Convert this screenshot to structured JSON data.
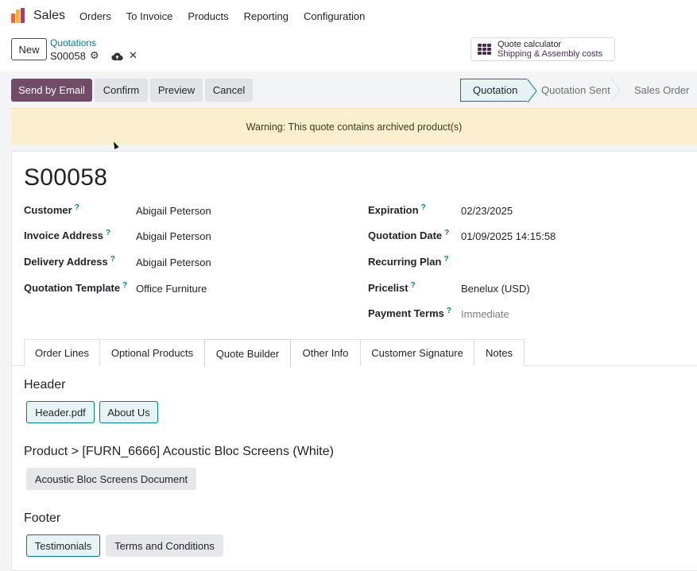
{
  "nav": {
    "app_name": "Sales",
    "items": [
      "Orders",
      "To Invoice",
      "Products",
      "Reporting",
      "Configuration"
    ]
  },
  "control": {
    "new_label": "New",
    "breadcrumb": "Quotations",
    "record_name": "S00058",
    "calculator_title": "Quote calculator",
    "calculator_subtitle": "Shipping & Assembly costs"
  },
  "actions": {
    "send_email": "Send by Email",
    "confirm": "Confirm",
    "preview": "Preview",
    "cancel": "Cancel"
  },
  "status": {
    "stages": [
      "Quotation",
      "Quotation Sent",
      "Sales Order"
    ],
    "active": "Quotation"
  },
  "warning": "Warning: This quote contains archived product(s)",
  "record": {
    "title": "S00058",
    "help_mark": "?",
    "left_fields": [
      {
        "label": "Customer",
        "value": "Abigail Peterson"
      },
      {
        "label": "Invoice Address",
        "value": "Abigail Peterson"
      },
      {
        "label": "Delivery Address",
        "value": "Abigail Peterson"
      },
      {
        "label": "Quotation Template",
        "value": "Office Furniture"
      }
    ],
    "right_fields": [
      {
        "label": "Expiration",
        "value": "02/23/2025"
      },
      {
        "label": "Quotation Date",
        "value": "01/09/2025 14:15:58"
      },
      {
        "label": "Recurring Plan",
        "value": ""
      },
      {
        "label": "Pricelist",
        "value": "Benelux (USD)"
      },
      {
        "label": "Payment Terms",
        "value": "Immediate"
      }
    ]
  },
  "tabs": [
    "Order Lines",
    "Optional Products",
    "Quote Builder",
    "Other Info",
    "Customer Signature",
    "Notes"
  ],
  "active_tab": "Quote Builder",
  "quote_builder": {
    "header_title": "Header",
    "header_docs": [
      "Header.pdf",
      "About Us"
    ],
    "product_title": "Product > [FURN_6666] Acoustic Bloc Screens (White)",
    "product_docs": [
      "Acoustic Bloc Screens Document"
    ],
    "footer_title": "Footer",
    "footer_docs": [
      "Testimonials",
      "Terms and Conditions"
    ]
  },
  "colors": {
    "primary": "#714b67",
    "accent": "#017e84",
    "warning_bg": "#fbefcf"
  }
}
